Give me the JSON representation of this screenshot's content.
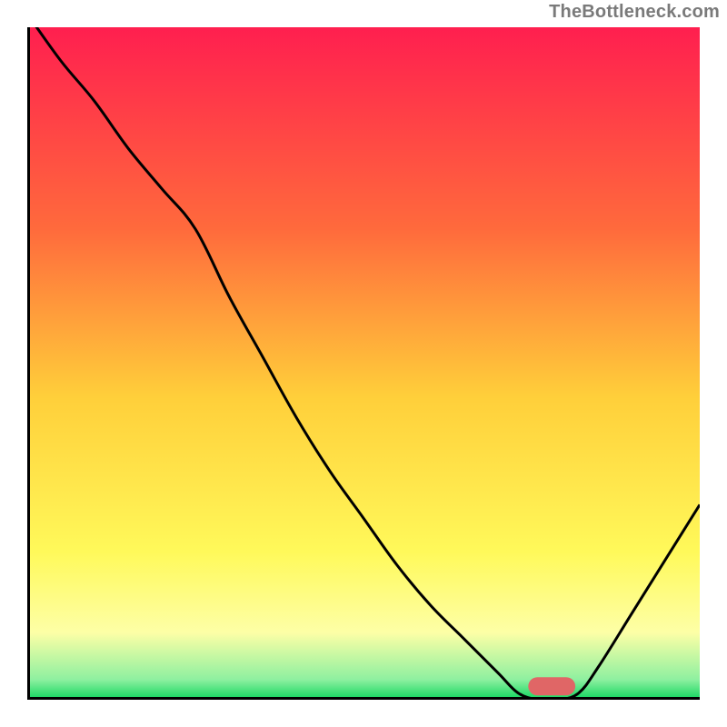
{
  "attribution": "TheBottleneck.com",
  "chart_data": {
    "type": "line",
    "title": "",
    "xlabel": "",
    "ylabel": "",
    "xlim": [
      0,
      100
    ],
    "ylim": [
      0,
      100
    ],
    "grid": false,
    "curve_description": "bottleneck curve, y from 100 down to 0 valley around x≈78 then rising",
    "optimum_x_range": [
      75,
      82
    ],
    "x": [
      0,
      5,
      10,
      15,
      20,
      25,
      30,
      35,
      40,
      45,
      50,
      55,
      60,
      65,
      70,
      73,
      76,
      79,
      82,
      85,
      90,
      95,
      100
    ],
    "y": [
      102,
      95,
      89,
      82,
      76,
      70,
      60,
      51,
      42,
      34,
      27,
      20,
      14,
      9,
      4,
      1,
      0,
      0,
      1,
      5,
      13,
      21,
      29
    ],
    "optimum_marker": {
      "x": 78,
      "y": 2,
      "width_pct": 7,
      "color": "#e06666"
    },
    "gradient_stops": [
      {
        "pct": 0,
        "color": "#ff1f4f"
      },
      {
        "pct": 30,
        "color": "#ff6a3c"
      },
      {
        "pct": 55,
        "color": "#ffcf3a"
      },
      {
        "pct": 78,
        "color": "#fff95a"
      },
      {
        "pct": 90,
        "color": "#fdffa6"
      },
      {
        "pct": 97,
        "color": "#8ef0a0"
      },
      {
        "pct": 100,
        "color": "#0fd65e"
      }
    ]
  }
}
